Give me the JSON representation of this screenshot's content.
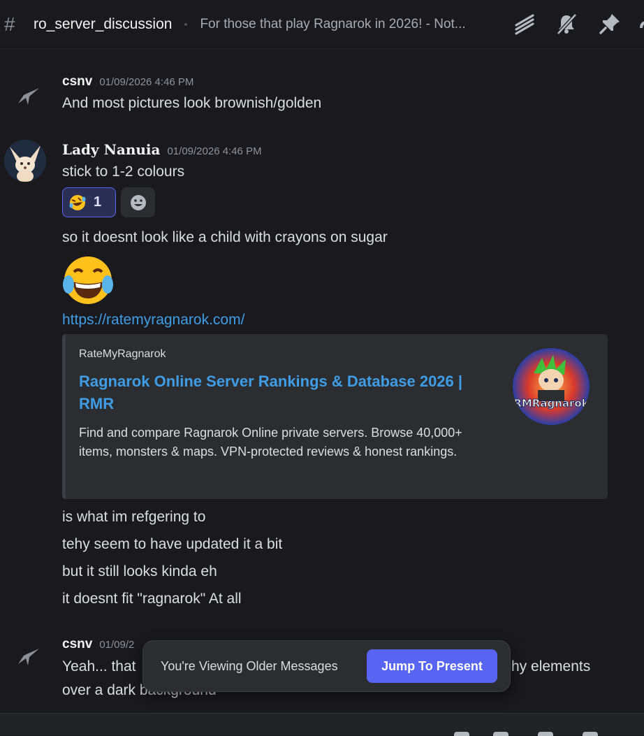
{
  "header": {
    "channel_name": "ro_server_discussion",
    "topic": "For those that play Ragnarok in 2026! - Not...",
    "icons": [
      "threads-icon",
      "notification-muted-icon",
      "pin-icon",
      "members-icon"
    ]
  },
  "messages": {
    "csnv_1": {
      "username": "csnv",
      "timestamp": "01/09/2026 4:46 PM",
      "text": "And most pictures look brownish/golden"
    },
    "lady": {
      "username": "Lady Nanuia",
      "timestamp": "01/09/2026 4:46 PM",
      "text1": "stick to 1-2 colours",
      "reaction_count": "1",
      "text2": "so it doesnt look like a child with crayons on sugar",
      "link": "https://ratemyragnarok.com/",
      "embed": {
        "provider": "RateMyRagnarok",
        "title": "Ragnarok Online Server Rankings & Database 2026 | RMR",
        "description": "Find and compare Ragnarok Online private servers. Browse 40,000+ items, monsters & maps. VPN-protected reviews & honest rankings.",
        "thumb_logo": "RMRagnarok"
      },
      "text3": "is what im refgering to",
      "text4": "tehy seem to have updated it a bit",
      "text5": "but it still looks kinda eh",
      "text6": "it doesnt fit \"ragnarok\" At all"
    },
    "csnv_2": {
      "username": "csnv",
      "timestamp_partial": "01/09/2",
      "text1_partial": "Yeah... that",
      "text1_end": "hy elements",
      "text2_partial": "over a dark background"
    }
  },
  "toast": {
    "text": "You're Viewing Older Messages",
    "button": "Jump To Present"
  },
  "colors": {
    "accent": "#5865f2",
    "link": "#3e9de6",
    "background": "#1a1a1e"
  }
}
